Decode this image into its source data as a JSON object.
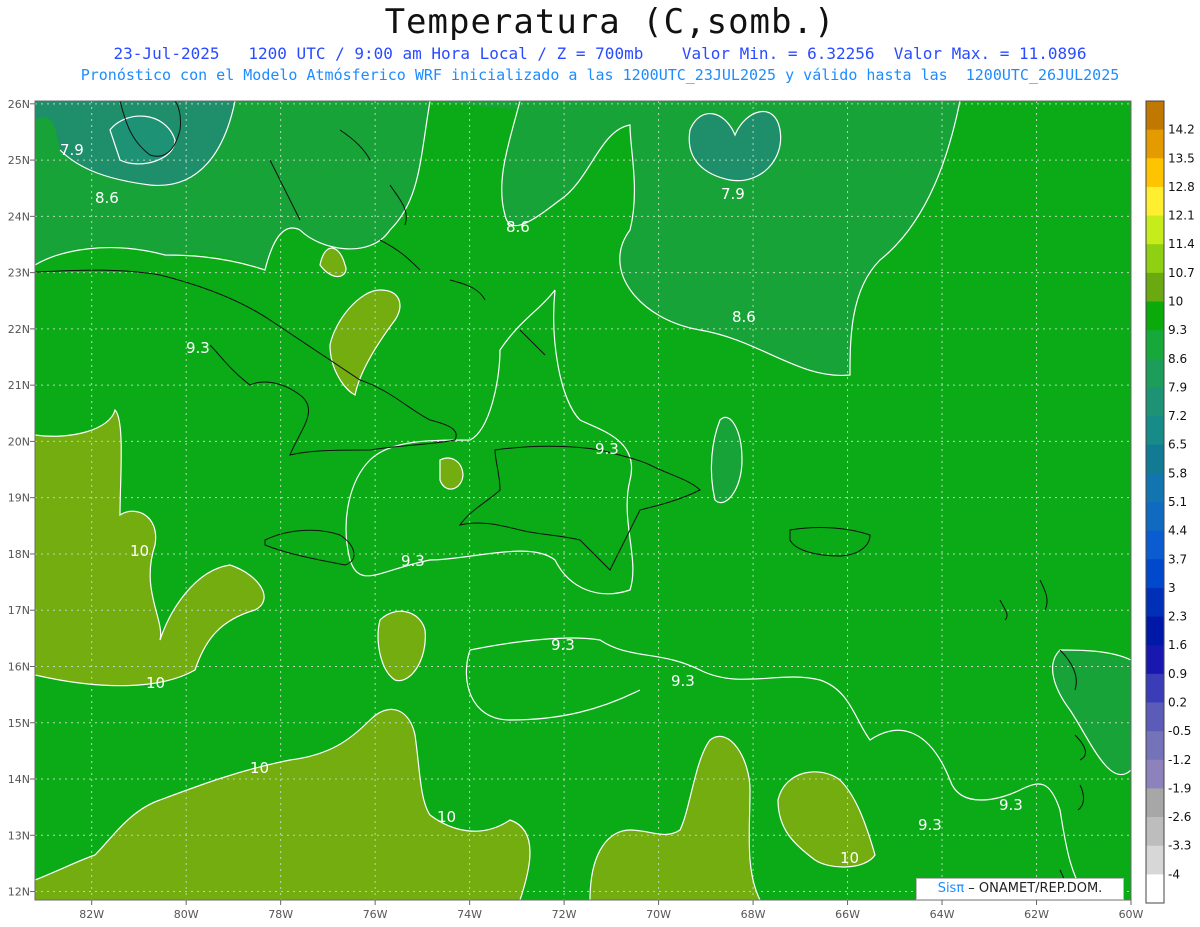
{
  "header": {
    "title": "Temperatura (C,somb.)",
    "info_line": "23-Jul-2025   1200 UTC / 9:00 am Hora Local / Z = 700mb    Valor Min. = 6.32256  Valor Max. = 11.0896",
    "model_line": "Pronóstico con el Modelo Atmósferico WRF inicializado a las 1200UTC_23JUL2025 y válido hasta las  1200UTC_26JUL2025"
  },
  "map": {
    "lat_labels": [
      "26N",
      "25N",
      "24N",
      "23N",
      "22N",
      "21N",
      "20N",
      "19N",
      "18N",
      "17N",
      "16N",
      "15N",
      "14N",
      "13N",
      "12N"
    ],
    "lon_labels": [
      "82W",
      "80W",
      "78W",
      "76W",
      "74W",
      "72W",
      "70W",
      "68W",
      "66W",
      "64W",
      "62W",
      "60W"
    ],
    "contour_labels": [
      "7.9",
      "8.6",
      "7.9",
      "8.6",
      "8.6",
      "9.3",
      "9.3",
      "9.3",
      "9.3",
      "9.3",
      "9.3",
      "9.3",
      "10",
      "10",
      "10",
      "10",
      "10"
    ],
    "fill_colors": {
      "level_7_9": "#1e8f6a",
      "level_8_6": "#17a337",
      "level_9_3": "#0aab17",
      "level_10": "#73ad0f"
    }
  },
  "colorbar": {
    "labels": [
      "14.2",
      "13.5",
      "12.8",
      "12.1",
      "11.4",
      "10.7",
      "10",
      "9.3",
      "8.6",
      "7.9",
      "7.2",
      "6.5",
      "5.8",
      "5.1",
      "4.4",
      "3.7",
      "3",
      "2.3",
      "1.6",
      "0.9",
      "0.2",
      "-0.5",
      "-1.2",
      "-1.9",
      "-2.6",
      "-3.3",
      "-4"
    ],
    "colors": [
      "#c07800",
      "#e49b00",
      "#ffc400",
      "#ffef30",
      "#c6ec1c",
      "#8fd012",
      "#6aaa10",
      "#0aaa0a",
      "#17a83a",
      "#1c9e5a",
      "#1e9275",
      "#168b88",
      "#137a93",
      "#1275b0",
      "#106bc0",
      "#0b5cd0",
      "#0049cc",
      "#0030b8",
      "#0018a8",
      "#1818b0",
      "#3a3cb8",
      "#5a5cb8",
      "#7472b8",
      "#8d82bc",
      "#a7a7a7",
      "#bdbdbd",
      "#d7d7d7",
      "#ffffff"
    ]
  },
  "credit": {
    "sis": "Sisπ",
    "org": " – ONAMET/REP.DOM."
  }
}
